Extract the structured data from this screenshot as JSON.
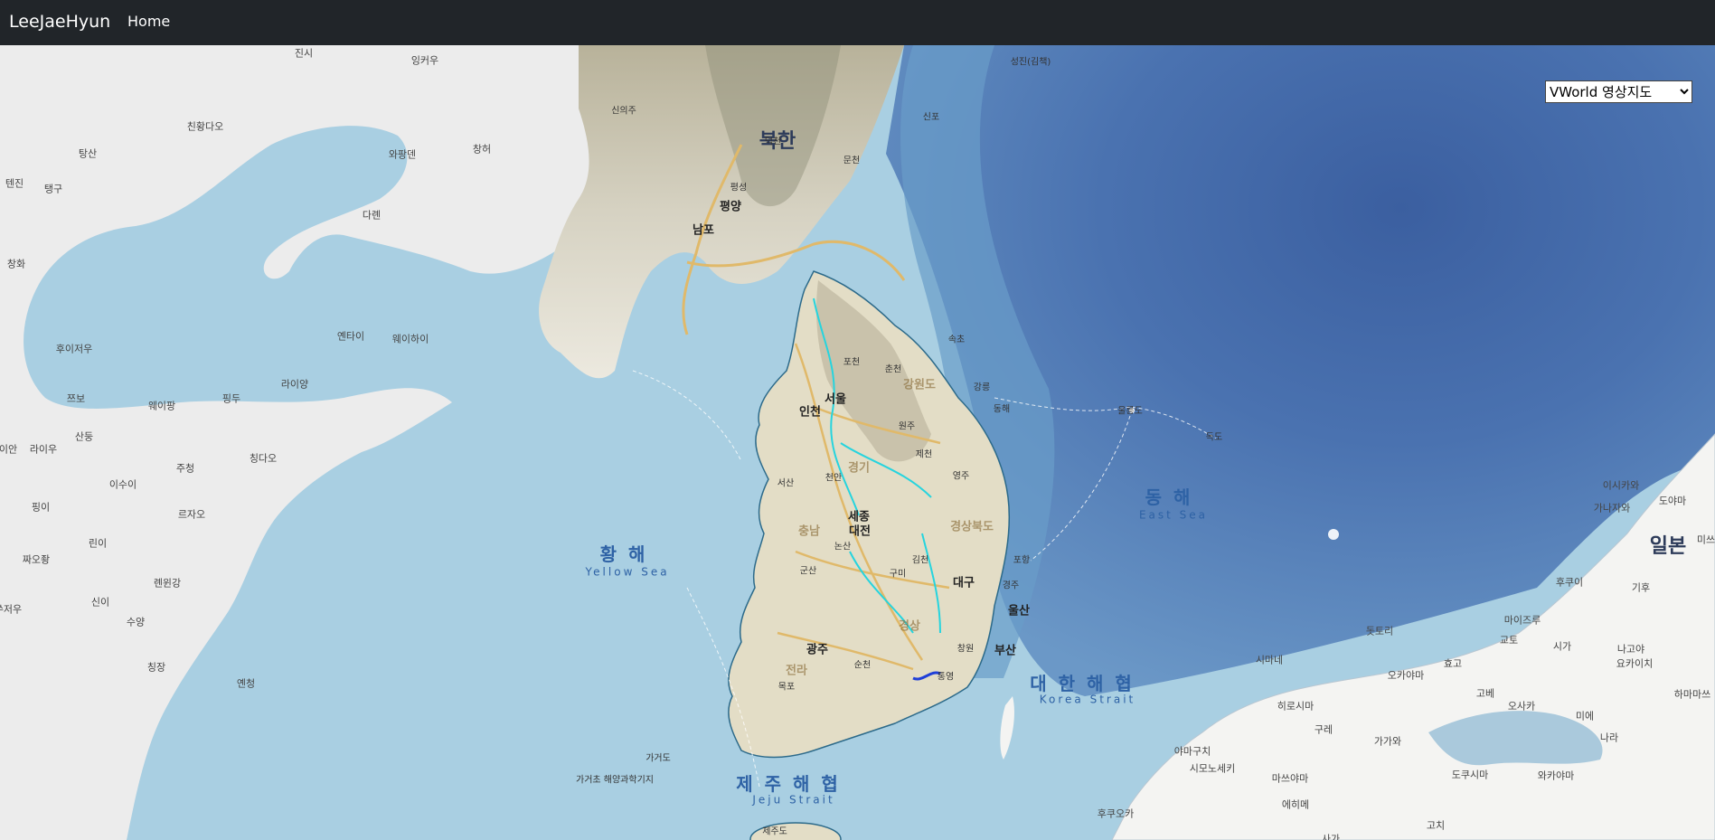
{
  "navbar": {
    "brand": "LeeJaeHyun",
    "home_link": "Home"
  },
  "map_control": {
    "selected": "VWorld 영상지도",
    "options": [
      "VWorld 영상지도"
    ]
  },
  "map": {
    "countries": [
      "북한",
      "일본"
    ],
    "seas": [
      {
        "ko": "황 해",
        "en": "Yellow Sea"
      },
      {
        "ko": "동 해",
        "en": "East Sea"
      },
      {
        "ko": "대 한 해 협",
        "en": "Korea Strait"
      },
      {
        "ko": "제 주 해 협",
        "en": "Jeju Strait"
      }
    ],
    "china_labels": [
      "진시",
      "잉커우",
      "친황다오",
      "탕산",
      "텐진",
      "탱구",
      "창허",
      "와팡덴",
      "다롄",
      "창화",
      "후이저우",
      "옌타이",
      "웨이하이",
      "라이양",
      "쯔보",
      "웨이팡",
      "핑두",
      "산둥",
      "라이우",
      "이안",
      "주청",
      "칭다오",
      "이수이",
      "르자오",
      "핑이",
      "린이",
      "짜오좡",
      "롄윈강",
      "신이",
      "쑤저우",
      "수양",
      "칭장",
      "옌청"
    ],
    "nk_labels": [
      "신의주",
      "덕천",
      "평성",
      "평양",
      "남포",
      "문천",
      "신포",
      "성진(김책)"
    ],
    "sk_cities": [
      "서울",
      "인천",
      "포천",
      "춘천",
      "속초",
      "강릉",
      "동해",
      "원주",
      "제천",
      "울릉도",
      "독도",
      "영주",
      "천안",
      "서산",
      "세종",
      "대전",
      "논산",
      "군산",
      "김천",
      "포항",
      "구미",
      "대구",
      "경주",
      "울산",
      "광주",
      "순천",
      "부산",
      "창원",
      "통영",
      "목포"
    ],
    "sk_provinces": [
      "강원도",
      "경기",
      "경상북도",
      "충남",
      "전라",
      "경상"
    ],
    "japan_labels": [
      "이시카와",
      "도야마",
      "가나자와",
      "후쿠이",
      "기후",
      "마이즈루",
      "교토",
      "시가",
      "나고야",
      "요카이치",
      "미에",
      "나라",
      "오사카",
      "고베",
      "효고",
      "오카야마",
      "돗토리",
      "시마네",
      "히로시마",
      "구레",
      "가가와",
      "도쿠시마",
      "와카야마",
      "야마구치",
      "시모노세키",
      "후쿠오카",
      "마쓰야마",
      "에히메",
      "고치",
      "사가",
      "하마마쓰",
      "미쓰"
    ],
    "misc_labels": [
      "가거초 해양과학기지",
      "가거도",
      "제주도"
    ]
  }
}
